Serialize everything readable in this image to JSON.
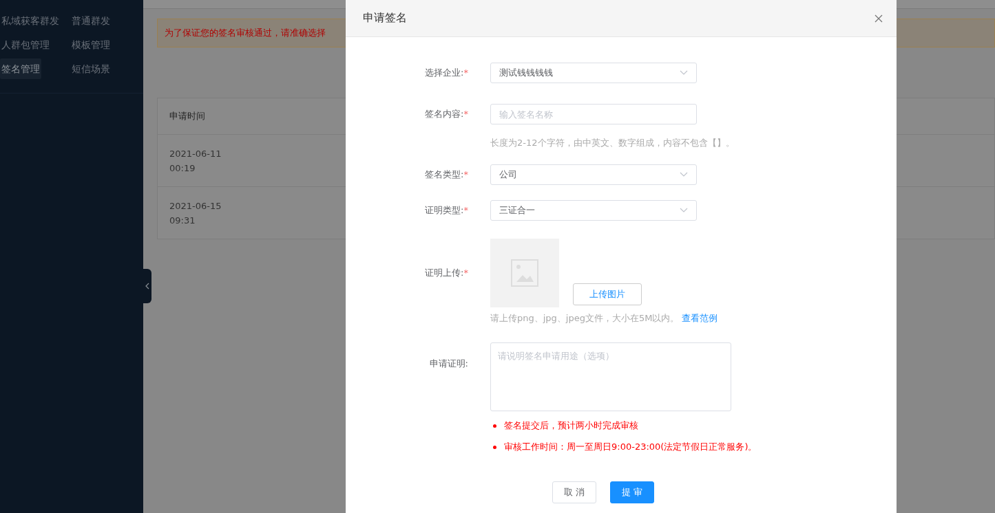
{
  "sidebar": {
    "items": [
      {
        "label": "私域获客群发",
        "selected": false
      },
      {
        "label": "普通群发",
        "selected": false
      },
      {
        "label": "人群包管理",
        "selected": false
      },
      {
        "label": "模板管理",
        "selected": false
      },
      {
        "label": "签名管理",
        "selected": true
      },
      {
        "label": "短信场景",
        "selected": false
      }
    ]
  },
  "alert": {
    "text": "为了保证您的签名审核通过，请准确选择"
  },
  "table": {
    "columns": [
      "申请时间"
    ],
    "rows": [
      {
        "date": "2021-06-11",
        "time": "00:19"
      },
      {
        "date": "2021-06-15",
        "time": "09:31"
      }
    ]
  },
  "dialog": {
    "title": "申请签名",
    "fields": [
      {
        "kind": "select",
        "label": "选择企业:",
        "mark": "*",
        "value": "测试钱钱钱钱"
      },
      {
        "kind": "input",
        "label": "签名内容:",
        "mark": "*",
        "placeholder": "输入签名名称",
        "hint": "长度为2-12个字符，由中英文、数字组成，内容不包含【】。"
      },
      {
        "kind": "select",
        "label": "签名类型:",
        "mark": "*",
        "value": "公司"
      },
      {
        "kind": "select",
        "label": "证明类型:",
        "mark": "*",
        "value": "三证合一"
      },
      {
        "kind": "upload",
        "label": "证明上传:",
        "mark": "*",
        "button": "上传图片",
        "hint": "请上传png、jpg、jpeg文件，大小在5M以内。",
        "link": "查看范例"
      },
      {
        "kind": "textarea",
        "label": "申请证明:",
        "placeholder": "请说明签名申请用途（选项）",
        "notes": [
          "签名提交后，预计两小时完成审核",
          "审核工作时间：周一至周日9:00-23:00(法定节假日正常服务)。"
        ]
      }
    ],
    "buttons": [
      {
        "label": "取 消",
        "kind": "default"
      },
      {
        "label": "提 审",
        "kind": "primary"
      }
    ]
  }
}
